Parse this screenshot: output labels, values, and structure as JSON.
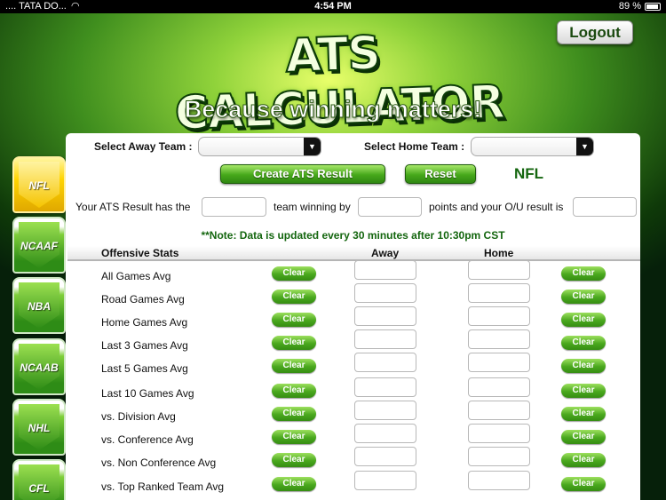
{
  "status_bar": {
    "carrier": ".... TATA DO...",
    "wifi_icon": "wifi-icon",
    "time": "4:54 PM",
    "battery": "89 %"
  },
  "header": {
    "title": "ATS CALCULATOR",
    "tagline": "Because winning matters!",
    "logout_label": "Logout"
  },
  "sports_tabs": [
    {
      "label": "NFL",
      "active": true
    },
    {
      "label": "NCAAF",
      "active": false
    },
    {
      "label": "NBA",
      "active": false
    },
    {
      "label": "NCAAB",
      "active": false
    },
    {
      "label": "NHL",
      "active": false
    },
    {
      "label": "CFL",
      "active": false
    }
  ],
  "form": {
    "away_team_label": "Select Away Team :",
    "away_team_value": "",
    "home_team_label": "Select Home Team :",
    "home_team_value": "",
    "create_button": "Create  ATS Result",
    "reset_button": "Reset",
    "sport_title": "NFL",
    "result_text_1": "Your ATS Result has the",
    "result_text_2": "team winning by",
    "result_text_3": "points and your O/U result is",
    "note": "**Note: Data is updated every 30 minutes after 10:30pm CST"
  },
  "stats": {
    "header_offensive": "Offensive Stats",
    "header_away": "Away",
    "header_home": "Home",
    "clear_label": "Clear",
    "rows": [
      "All Games Avg",
      "Road Games Avg",
      "Home Games Avg",
      "Last 3 Games Avg",
      "Last 5 Games Avg",
      "Last 10 Games Avg",
      "vs. Division Avg",
      "vs. Conference Avg",
      "vs. Non Conference Avg",
      "vs. Top Ranked Team Avg"
    ]
  },
  "colors": {
    "accent_green": "#14660f",
    "button_green": "#46a81a",
    "active_tab": "#ffd400"
  }
}
